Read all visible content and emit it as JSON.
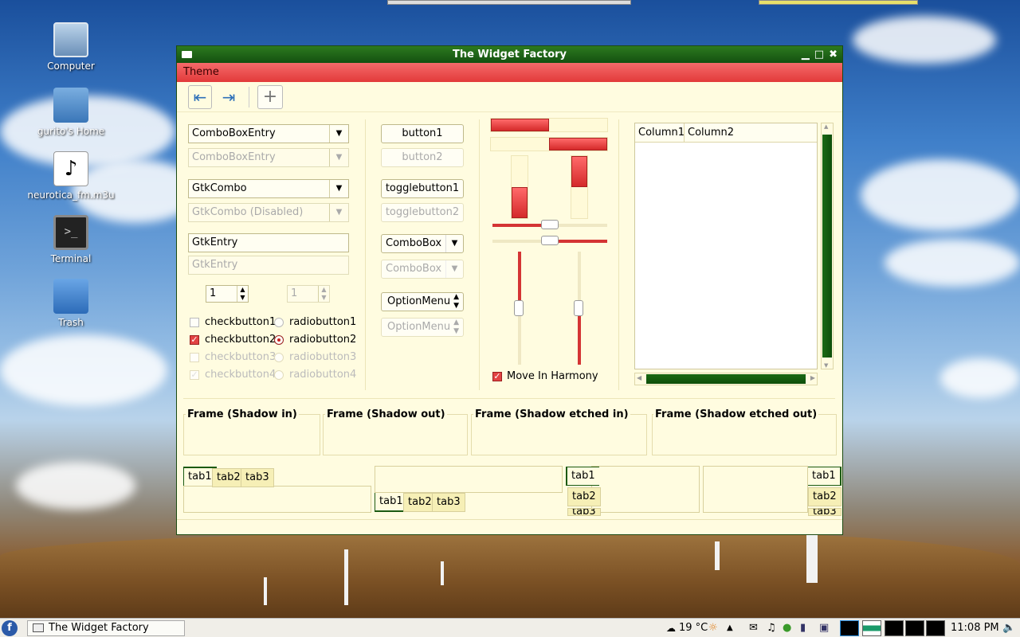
{
  "desktop": {
    "icons": [
      {
        "label": "Computer",
        "icon": "computer-icon"
      },
      {
        "label": "gurito's Home",
        "icon": "home-folder-icon"
      },
      {
        "label": "neurotica_fm.m3u",
        "icon": "music-file-icon"
      },
      {
        "label": "Terminal",
        "icon": "terminal-icon"
      },
      {
        "label": "Trash",
        "icon": "trash-icon"
      }
    ]
  },
  "window": {
    "title": "The Widget Factory",
    "menu": {
      "theme": "Theme"
    },
    "combo_entry": "ComboBoxEntry",
    "combo_entry_disabled": "ComboBoxEntry",
    "gtk_combo": "GtkCombo",
    "gtk_combo_disabled": "GtkCombo (Disabled)",
    "entry": "GtkEntry",
    "entry_disabled": "GtkEntry",
    "spin": "1",
    "spin_disabled": "1",
    "checks": [
      "checkbutton1",
      "checkbutton2",
      "checkbutton3",
      "checkbutton4"
    ],
    "radios": [
      "radiobutton1",
      "radiobutton2",
      "radiobutton3",
      "radiobutton4"
    ],
    "buttons": {
      "button1": "button1",
      "button2": "button2",
      "toggle1": "togglebutton1",
      "toggle2": "togglebutton2",
      "combobox": "ComboBox",
      "combobox_disabled": "ComboBox",
      "optionmenu": "OptionMenu",
      "optionmenu_disabled": "OptionMenu"
    },
    "move_in_harmony": "Move In Harmony",
    "tree_columns": [
      "Column1",
      "Column2"
    ],
    "frames": [
      "Frame (Shadow in)",
      "Frame (Shadow out)",
      "Frame (Shadow etched in)",
      "Frame (Shadow etched out)"
    ],
    "tabs": [
      "tab1",
      "tab2",
      "tab3"
    ],
    "progress": {
      "h1": 0.5,
      "h2": 0.5,
      "v1": 0.5,
      "v2": 0.5
    },
    "sliders": {
      "h1": 0.5,
      "h2": 0.5,
      "v1": 0.5,
      "v2": 0.5
    }
  },
  "taskbar": {
    "task": "The Widget Factory",
    "weather": "19 °C",
    "clock": "11:08 PM"
  },
  "colors": {
    "accent": "#e23a3a",
    "titlebar": "#145010",
    "window_bg": "#fffce0"
  }
}
